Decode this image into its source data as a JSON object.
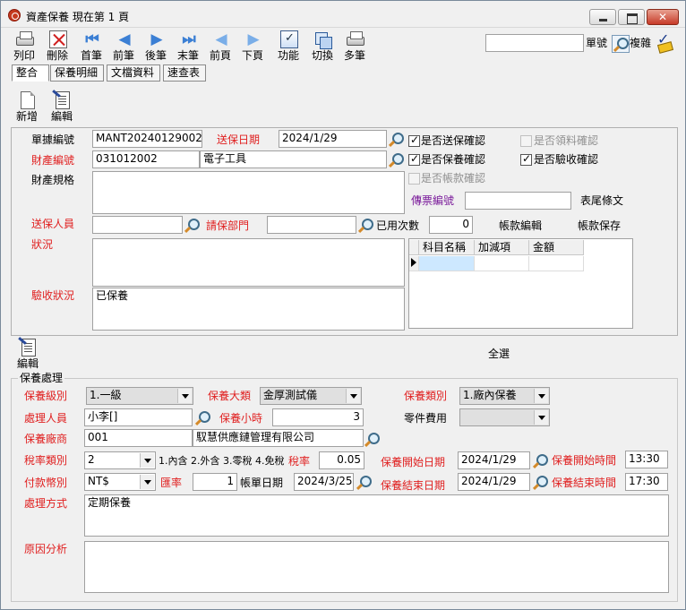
{
  "window": {
    "title": "資產保養  現在第 1 頁",
    "close_label": "✕"
  },
  "toolbar": {
    "print": "列印",
    "delete": "刪除",
    "first": "首筆",
    "prev": "前筆",
    "next": "後筆",
    "last": "末筆",
    "prev_page": "前頁",
    "next_page": "下頁",
    "function": "功能",
    "switch": "切換",
    "multi": "多筆"
  },
  "search": {
    "value": "",
    "doc_no_label": "單號",
    "complex_label": "複雜"
  },
  "tabs": [
    "整合",
    "保養明細",
    "文檔資料",
    "速查表"
  ],
  "sub_toolbar": {
    "add": "新增",
    "edit": "編輯"
  },
  "form": {
    "doc_no_label": "單據編號",
    "doc_no": "MANT20240129002",
    "send_date_label": "送保日期",
    "send_date": "2024/1/29",
    "asset_no_label": "財產編號",
    "asset_no": "031012002",
    "asset_name": "電子工具",
    "asset_spec_label": "財產規格",
    "asset_spec": "",
    "voucher_label": "傳票編號",
    "voucher": "",
    "footer_text_label": "表尾條文",
    "sender_label": "送保人員",
    "sender": "",
    "dept_label": "請保部門",
    "dept": "",
    "used_count_label": "已用次數",
    "used_count": "0",
    "account_edit_label": "帳款編輯",
    "account_save_label": "帳款保存",
    "status_label": "狀況",
    "status": "",
    "accept_label": "驗收狀況",
    "accept": "已保養"
  },
  "checks": {
    "send_confirm": "是否送保確認",
    "receive_confirm": "是否領料確認",
    "maint_confirm": "是否保養確認",
    "accept_confirm": "是否驗收確認",
    "account_confirm": "是否帳款確認"
  },
  "grid": {
    "columns": [
      "科目名稱",
      "加減項",
      "金額"
    ]
  },
  "section2": {
    "edit": "編輯",
    "select_all": "全選",
    "legend": "保養處理",
    "level_label": "保養級別",
    "level": "1.一級",
    "category_label": "保養大類",
    "category": "金厚測試儀",
    "type_label": "保養類別",
    "type": "1.廠內保養",
    "handler_label": "處理人員",
    "handler": "小李[]",
    "hours_label": "保養小時",
    "hours": "3",
    "parts_fee_label": "零件費用",
    "parts_fee": "",
    "vendor_label": "保養廠商",
    "vendor_code": "001",
    "vendor_name": "馭慧供應鏈管理有限公司",
    "tax_type_label": "稅率類別",
    "tax_type": "2",
    "tax_hint": "1.內含 2.外含 3.零稅 4.免稅",
    "tax_rate_label": "稅率",
    "tax_rate": "0.05",
    "start_date_label": "保養開始日期",
    "start_date": "2024/1/29",
    "start_time_label": "保養開始時間",
    "start_time": "13:30",
    "currency_label": "付款幣別",
    "currency": "NT$",
    "rate_label": "匯率",
    "rate": "1",
    "bill_date_label": "帳單日期",
    "bill_date": "2024/3/25",
    "end_date_label": "保養結束日期",
    "end_date": "2024/1/29",
    "end_time_label": "保養結束時間",
    "end_time": "17:30",
    "method_label": "處理方式",
    "method": "定期保養",
    "cause_label": "原因分析",
    "cause": ""
  }
}
